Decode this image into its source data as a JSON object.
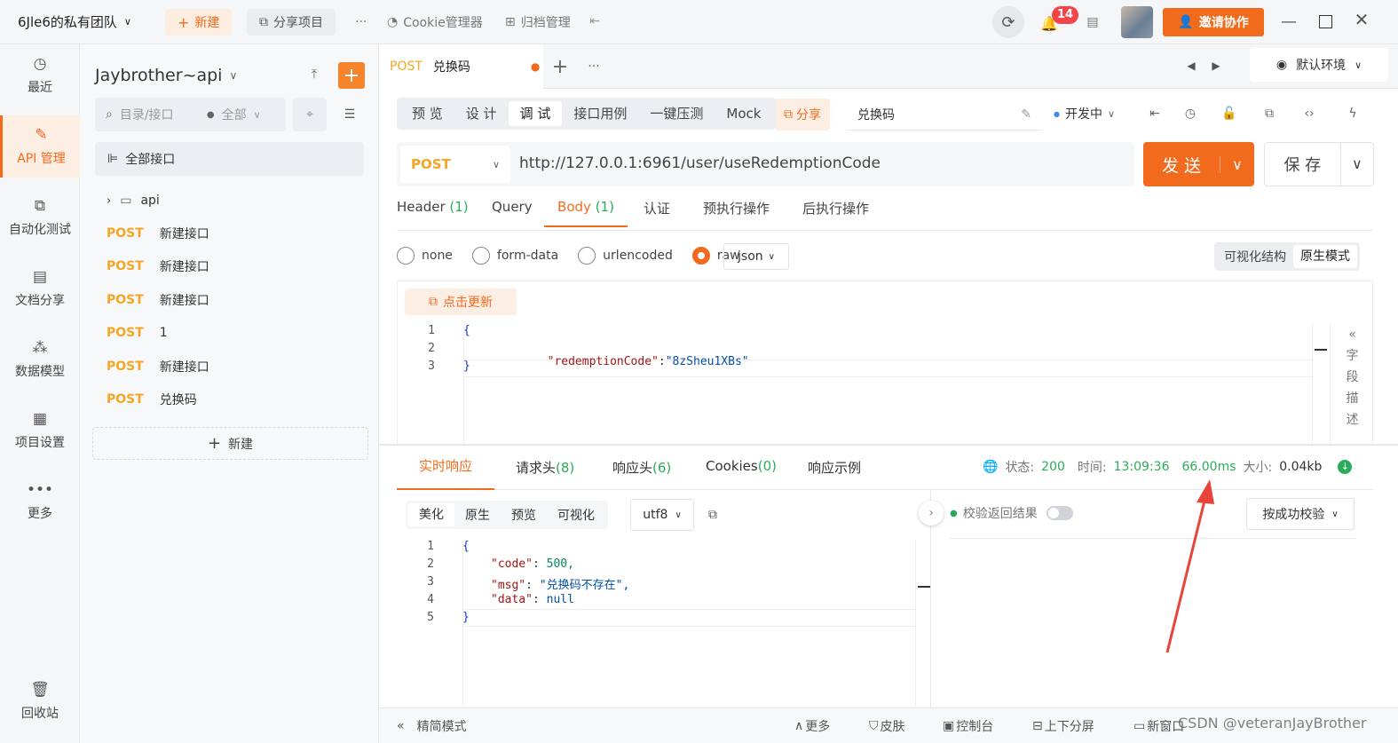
{
  "topbar": {
    "team_name": "6Jle6的私有团队",
    "new_label": "新建",
    "share_project_label": "分享项目",
    "more_label": "···",
    "cookie_label": "Cookie管理器",
    "archive_label": "归档管理",
    "notification_count": "14",
    "invite_label": "邀请协作"
  },
  "sidebar": {
    "items": [
      {
        "label": "最近",
        "icon": "clock-icon"
      },
      {
        "label": "API 管理",
        "icon": "api-icon"
      },
      {
        "label": "自动化测试",
        "icon": "automation-icon"
      },
      {
        "label": "文档分享",
        "icon": "doc-share-icon"
      },
      {
        "label": "数据模型",
        "icon": "data-model-icon"
      },
      {
        "label": "项目设置",
        "icon": "settings-icon"
      },
      {
        "label": "更多",
        "icon": "more-icon"
      },
      {
        "label": "回收站",
        "icon": "trash-icon"
      }
    ]
  },
  "tree": {
    "project_title": "Jaybrother~api",
    "search_placeholder": "目录/接口",
    "filter_label": "全部",
    "all_apis_label": "全部接口",
    "folder": "api",
    "apis": [
      {
        "method": "POST",
        "name": "新建接口"
      },
      {
        "method": "POST",
        "name": "新建接口"
      },
      {
        "method": "POST",
        "name": "新建接口"
      },
      {
        "method": "POST",
        "name": "1"
      },
      {
        "method": "POST",
        "name": "新建接口"
      },
      {
        "method": "POST",
        "name": "兑换码"
      }
    ],
    "new_label": "新建"
  },
  "tab": {
    "method": "POST",
    "name": "兑换码",
    "env_label": "默认环境"
  },
  "mode_tabs": [
    "预 览",
    "设 计",
    "调 试",
    "接口用例",
    "一键压测",
    "Mock"
  ],
  "toolbar": {
    "share_label": "分享",
    "api_name": "兑换码",
    "status": "开发中"
  },
  "request": {
    "method": "POST",
    "url": "http://127.0.0.1:6961/user/useRedemptionCode",
    "send_label": "发 送",
    "save_label": "保 存"
  },
  "req_tabs": {
    "header": "Header",
    "header_count": "(1)",
    "query": "Query",
    "body": "Body",
    "body_count": "(1)",
    "auth": "认证",
    "pre": "预执行操作",
    "post": "后执行操作"
  },
  "body_types": {
    "none": "none",
    "form_data": "form-data",
    "urlencoded": "urlencoded",
    "raw": "raw",
    "format": "json",
    "visual_label": "可视化结构",
    "raw_mode_label": "原生模式"
  },
  "update_label": "点击更新",
  "request_body_lines": [
    {
      "n": "1",
      "text": "{"
    },
    {
      "n": "2",
      "key": "\"redemptionCode\"",
      "sep": ":",
      "val": "\"8zSheu1XBs\""
    },
    {
      "n": "3",
      "text": "}"
    }
  ],
  "field_desc": [
    "字",
    "段",
    "描",
    "述"
  ],
  "response": {
    "tabs": {
      "realtime": "实时响应",
      "req_headers": "请求头",
      "req_headers_count": "(8)",
      "resp_headers": "响应头",
      "resp_headers_count": "(6)",
      "cookies": "Cookies",
      "cookies_count": "(0)",
      "example": "响应示例"
    },
    "status_label": "状态:",
    "status": "200",
    "time_label": "时间:",
    "time": "13:09:36",
    "duration": "66.00ms",
    "size_label": "大小:",
    "size": "0.04kb",
    "view_tabs": [
      "美化",
      "原生",
      "预览",
      "可视化"
    ],
    "encoding": "utf8",
    "validate_label": "校验返回结果",
    "validate_mode": "按成功校验",
    "lines": [
      {
        "n": "1",
        "text": "{"
      },
      {
        "n": "2",
        "key": "\"code\"",
        "val": "500,"
      },
      {
        "n": "3",
        "key": "\"msg\"",
        "val": "\"兑换码不存在\","
      },
      {
        "n": "4",
        "key": "\"data\"",
        "val": "null"
      },
      {
        "n": "5",
        "text": "}"
      }
    ]
  },
  "bottom": {
    "compact": "精简模式",
    "more": "更多",
    "skin": "皮肤",
    "console": "控制台",
    "split": "上下分屏",
    "new_window": "新窗口",
    "watermark": "CSDN @veteranJayBrother"
  },
  "colors": {
    "accent": "#f26b1d",
    "post": "#f5a623",
    "success": "#2aad5a",
    "annotation": "#e8443a"
  }
}
